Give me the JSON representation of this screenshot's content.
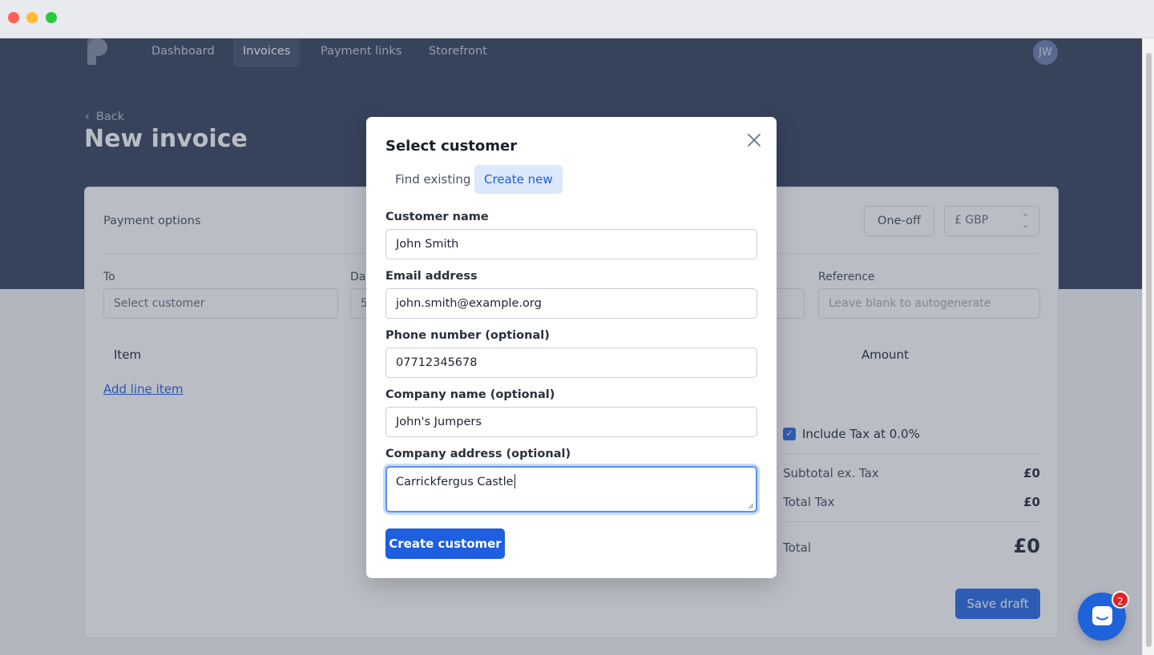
{
  "nav": {
    "items": [
      {
        "label": "Dashboard"
      },
      {
        "label": "Invoices"
      },
      {
        "label": "Payment links"
      },
      {
        "label": "Storefront"
      }
    ],
    "active": "Invoices",
    "avatar_initials": "JW"
  },
  "page": {
    "back_label": "Back",
    "title": "New invoice"
  },
  "invoice": {
    "payment_options_label": "Payment options",
    "one_off_label": "One-off",
    "currency_value": "£ GBP",
    "to_label": "To",
    "to_placeholder": "Select customer",
    "date_label": "Da",
    "date_value": "5",
    "reference_label": "Reference",
    "reference_placeholder": "Leave blank to autogenerate",
    "item_header": "Item",
    "amount_header": "Amount",
    "add_line_item": "Add line item",
    "include_tax_label": "Include Tax at 0.0%",
    "include_tax_checked": true,
    "subtotal_label": "Subtotal ex. Tax",
    "subtotal_value": "£0",
    "total_tax_label": "Total Tax",
    "total_tax_value": "£0",
    "total_label": "Total",
    "total_value": "£0",
    "save_draft": "Save draft"
  },
  "modal": {
    "title": "Select customer",
    "tabs": [
      {
        "label": "Find existing"
      },
      {
        "label": "Create new"
      }
    ],
    "active_tab": "Create new",
    "fields": {
      "customer_name": {
        "label": "Customer name",
        "value": "John Smith"
      },
      "email": {
        "label": "Email address",
        "value": "john.smith@example.org"
      },
      "phone": {
        "label": "Phone number (optional)",
        "value": "07712345678"
      },
      "company_name": {
        "label": "Company name (optional)",
        "value": "John's Jumpers"
      },
      "company_address": {
        "label": "Company address (optional)",
        "value": "Carrickfergus Castle"
      }
    },
    "submit_label": "Create customer"
  },
  "chat": {
    "badge_count": "2"
  },
  "colors": {
    "hero": "#3c4a63",
    "primary": "#1d5fe0",
    "tab_active_bg": "#dce8fb"
  }
}
